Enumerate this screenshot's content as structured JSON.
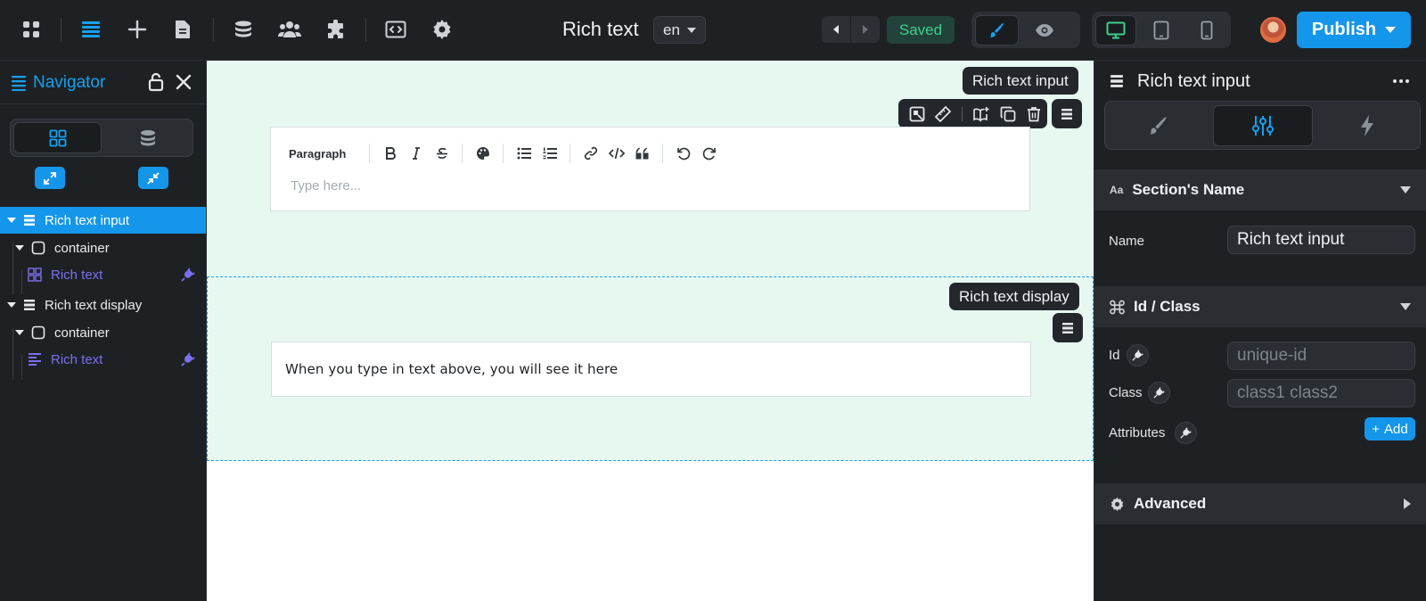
{
  "topbar": {
    "page_title": "Rich text",
    "language": "en",
    "status": "Saved",
    "publish_label": "Publish",
    "icons": [
      "apps-icon",
      "navigator-icon",
      "add-icon",
      "pages-icon",
      "cms-icon",
      "users-icon",
      "plugins-icon",
      "code-icon",
      "settings-icon"
    ]
  },
  "navigator": {
    "title": "Navigator",
    "tree": [
      {
        "label": "Rich text input",
        "selected": true
      },
      {
        "label": "container"
      },
      {
        "label": "Rich text",
        "linked": true
      },
      {
        "label": "Rich text display"
      },
      {
        "label": "container"
      },
      {
        "label": "Rich text",
        "linked": true
      }
    ]
  },
  "canvas": {
    "input_section_tag": "Rich text input",
    "display_section_tag": "Rich text display",
    "editor": {
      "paragraph_label": "Paragraph",
      "placeholder": "Type here..."
    },
    "display_text": "When you type in text above, you will see it here"
  },
  "properties": {
    "header_title": "Rich text input",
    "section_name": {
      "title": "Section's Name",
      "name_label": "Name",
      "name_value": "Rich text input"
    },
    "id_class": {
      "title": "Id / Class",
      "id_label": "Id",
      "id_placeholder": "unique-id",
      "class_label": "Class",
      "class_placeholder": "class1 class2",
      "attributes_label": "Attributes",
      "add_label": "Add"
    },
    "advanced": {
      "title": "Advanced"
    }
  },
  "colors": {
    "accent": "#1496ea",
    "canvas_section_bg": "#e7f8f1",
    "saved_green": "#3ecf8e",
    "linked_purple": "#7b6ff0",
    "panel_bg": "#1e2124"
  }
}
